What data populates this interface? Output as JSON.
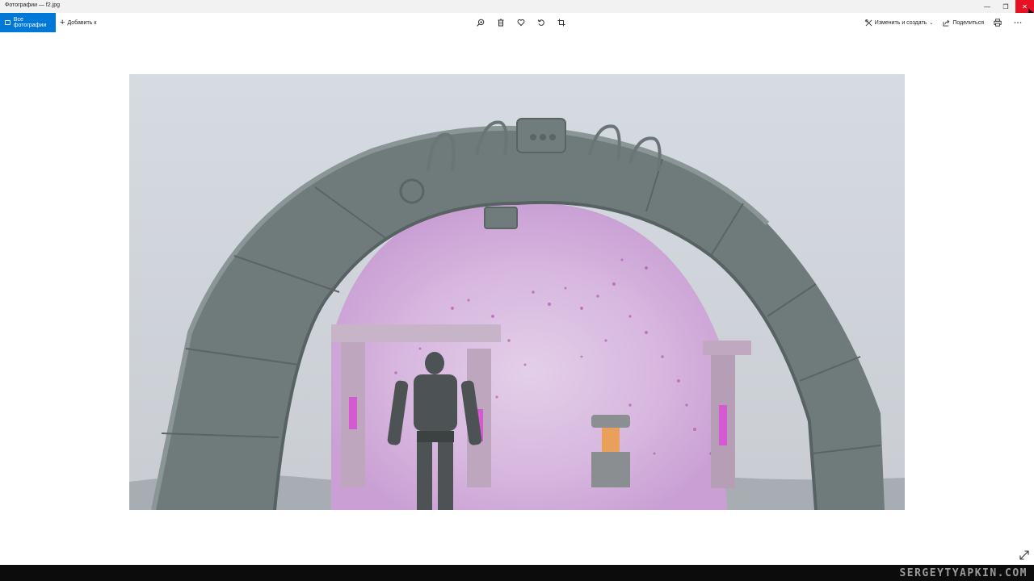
{
  "window": {
    "title": "Фотографии — f2.jpg",
    "minimize_label": "—",
    "maximize_label": "❐",
    "close_label": "✕",
    "close_color": "#e81123"
  },
  "toolbar": {
    "all_photos_label": "Все фотографии",
    "add_to_label": "Добавить к",
    "center_icons": [
      "zoom-in-icon",
      "delete-icon",
      "favorite-heart-icon",
      "rotate-icon",
      "crop-icon"
    ],
    "edit_create_label": "Изменить и создать",
    "share_label": "Поделиться",
    "accent_color": "#0078d7"
  },
  "viewer": {
    "image_subject": "stone portal arch with robot figure and pink particles",
    "expand_icon": "expand-icon"
  },
  "watermark": {
    "text": "SERGEYTYAPKIN.COM"
  }
}
